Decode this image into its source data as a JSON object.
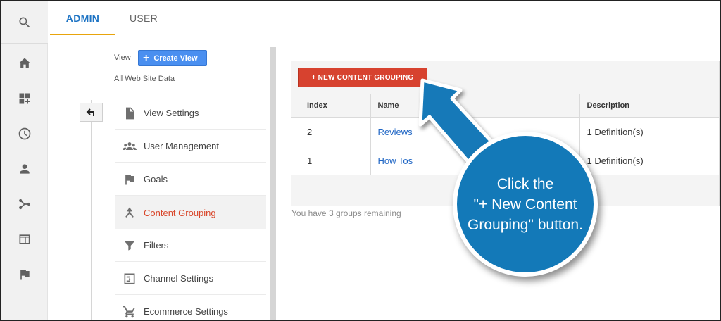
{
  "tabs": {
    "admin": "ADMIN",
    "user": "USER"
  },
  "view": {
    "label": "View",
    "create_button": "Create View",
    "create_plus": "+",
    "selected": "All Web Site Data"
  },
  "menu": [
    {
      "label": "View Settings",
      "icon": "document-icon"
    },
    {
      "label": "User Management",
      "icon": "users-icon"
    },
    {
      "label": "Goals",
      "icon": "flag-icon"
    },
    {
      "label": "Content Grouping",
      "icon": "content-grouping-icon",
      "active": true
    },
    {
      "label": "Filters",
      "icon": "filter-icon"
    },
    {
      "label": "Channel Settings",
      "icon": "channel-settings-icon"
    },
    {
      "label": "Ecommerce Settings",
      "icon": "cart-icon"
    }
  ],
  "content_grouping": {
    "new_button": "+ NEW CONTENT GROUPING",
    "columns": {
      "index": "Index",
      "name": "Name",
      "description": "Description"
    },
    "rows": [
      {
        "index": "2",
        "name": "Reviews",
        "description": "1 Definition(s)"
      },
      {
        "index": "1",
        "name": "How Tos",
        "description": "1 Definition(s)"
      }
    ],
    "remaining": "You have 3 groups remaining"
  },
  "callout": {
    "line1": "Click the",
    "line2": "\"+ New Content",
    "line3": "Grouping\" button."
  },
  "colors": {
    "accent_tab": "#1e74c4",
    "tab_underline": "#e8a40c",
    "create_button": "#4a8ff0",
    "new_button": "#d7422f",
    "active_menu_text": "#d9472b",
    "link": "#2167c5",
    "callout": "#1379b8"
  },
  "rail_icons": [
    "search-icon",
    "home-icon",
    "dashboard-icon",
    "clock-icon",
    "person-icon",
    "share-icon",
    "window-icon",
    "flag-icon"
  ]
}
